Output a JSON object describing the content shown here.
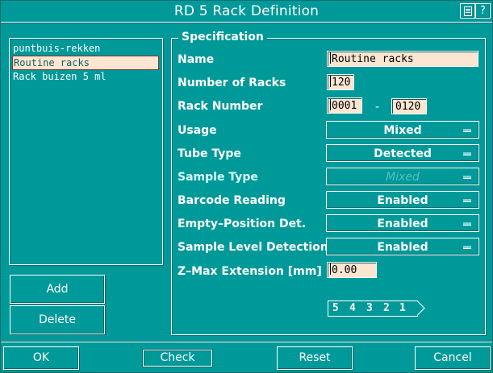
{
  "window": {
    "title": "RD 5 Rack Definition",
    "menu_icon": "document-icon",
    "help_label": "?"
  },
  "rack_list": {
    "items": [
      {
        "label": "puntbuis-rekken",
        "selected": false
      },
      {
        "label": "Routine racks",
        "selected": true
      },
      {
        "label": "Rack buizen 5 ml",
        "selected": false
      }
    ]
  },
  "list_buttons": {
    "add": "Add",
    "delete": "Delete"
  },
  "specification": {
    "legend": "Specification",
    "name_label": "Name",
    "name_value": "Routine racks",
    "num_racks_label": "Number of Racks",
    "num_racks_value": "120",
    "rack_number_label": "Rack Number",
    "rack_number_from": "0001",
    "rack_number_sep": "-",
    "rack_number_to": "0120",
    "usage_label": "Usage",
    "usage_value": "Mixed",
    "tube_type_label": "Tube Type",
    "tube_type_value": "Detected",
    "sample_type_label": "Sample Type",
    "sample_type_value": "Mixed",
    "barcode_label": "Barcode Reading",
    "barcode_value": "Enabled",
    "empty_pos_label": "Empty–Position Det.",
    "empty_pos_value": "Enabled",
    "sample_level_label": "Sample Level Detection",
    "sample_level_value": "Enabled",
    "zmax_label": "Z–Max Extension [mm]",
    "zmax_value": "0.00",
    "rack_positions": [
      "5",
      "4",
      "3",
      "2",
      "1"
    ]
  },
  "footer": {
    "ok": "OK",
    "check": "Check",
    "reset": "Reset",
    "cancel": "Cancel"
  }
}
